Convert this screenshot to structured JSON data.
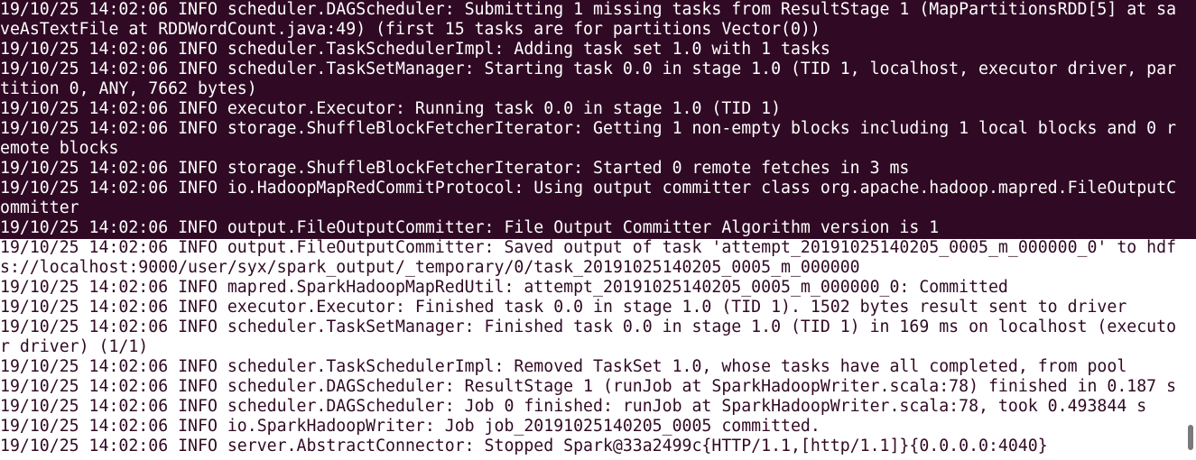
{
  "terminal": {
    "colors": {
      "background": "#300a24",
      "text": "#ffffff",
      "selection_background": "#ffffff",
      "selection_text": "#300a24"
    },
    "lines": [
      {
        "text": "19/10/25 14:02:06 INFO scheduler.DAGScheduler: Submitting 1 missing tasks from ResultStage 1 (MapPartitionsRDD[5] at saveAsTextFile at RDDWordCount.java:49) (first 15 tasks are for partitions Vector(0))",
        "selected": false
      },
      {
        "text": "19/10/25 14:02:06 INFO scheduler.TaskSchedulerImpl: Adding task set 1.0 with 1 tasks",
        "selected": false
      },
      {
        "text": "19/10/25 14:02:06 INFO scheduler.TaskSetManager: Starting task 0.0 in stage 1.0 (TID 1, localhost, executor driver, partition 0, ANY, 7662 bytes)",
        "selected": false
      },
      {
        "text": "19/10/25 14:02:06 INFO executor.Executor: Running task 0.0 in stage 1.0 (TID 1)",
        "selected": false
      },
      {
        "text": "19/10/25 14:02:06 INFO storage.ShuffleBlockFetcherIterator: Getting 1 non-empty blocks including 1 local blocks and 0 remote blocks",
        "selected": false
      },
      {
        "text": "19/10/25 14:02:06 INFO storage.ShuffleBlockFetcherIterator: Started 0 remote fetches in 3 ms",
        "selected": false
      },
      {
        "text": "19/10/25 14:02:06 INFO io.HadoopMapRedCommitProtocol: Using output committer class org.apache.hadoop.mapred.FileOutputCommitter",
        "selected": false
      },
      {
        "text": "19/10/25 14:02:06 INFO output.FileOutputCommitter: File Output Committer Algorithm version is 1",
        "selected": false
      },
      {
        "text": "19/10/25 14:02:06 INFO output.FileOutputCommitter: Saved output of task 'attempt_20191025140205_0005_m_000000_0' to hdfs://localhost:9000/user/syx/spark_output/_temporary/0/task_20191025140205_0005_m_000000",
        "selected": true
      },
      {
        "text": "19/10/25 14:02:06 INFO mapred.SparkHadoopMapRedUtil: attempt_20191025140205_0005_m_000000_0: Committed",
        "selected": true
      },
      {
        "text": "19/10/25 14:02:06 INFO executor.Executor: Finished task 0.0 in stage 1.0 (TID 1). 1502 bytes result sent to driver",
        "selected": true
      },
      {
        "text": "19/10/25 14:02:06 INFO scheduler.TaskSetManager: Finished task 0.0 in stage 1.0 (TID 1) in 169 ms on localhost (executor driver) (1/1)",
        "selected": true
      },
      {
        "text": "19/10/25 14:02:06 INFO scheduler.TaskSchedulerImpl: Removed TaskSet 1.0, whose tasks have all completed, from pool",
        "selected": true
      },
      {
        "text": "19/10/25 14:02:06 INFO scheduler.DAGScheduler: ResultStage 1 (runJob at SparkHadoopWriter.scala:78) finished in 0.187 s",
        "selected": true
      },
      {
        "text": "19/10/25 14:02:06 INFO scheduler.DAGScheduler: Job 0 finished: runJob at SparkHadoopWriter.scala:78, took 0.493844 s",
        "selected": true
      },
      {
        "text": "19/10/25 14:02:06 INFO io.SparkHadoopWriter: Job job_20191025140205_0005 committed.",
        "selected": true
      },
      {
        "text": "19/10/25 14:02:06 INFO server.AbstractConnector: Stopped Spark@33a2499c{HTTP/1.1,[http/1.1]}{0.0.0.0:4040}",
        "selected": true
      }
    ]
  }
}
